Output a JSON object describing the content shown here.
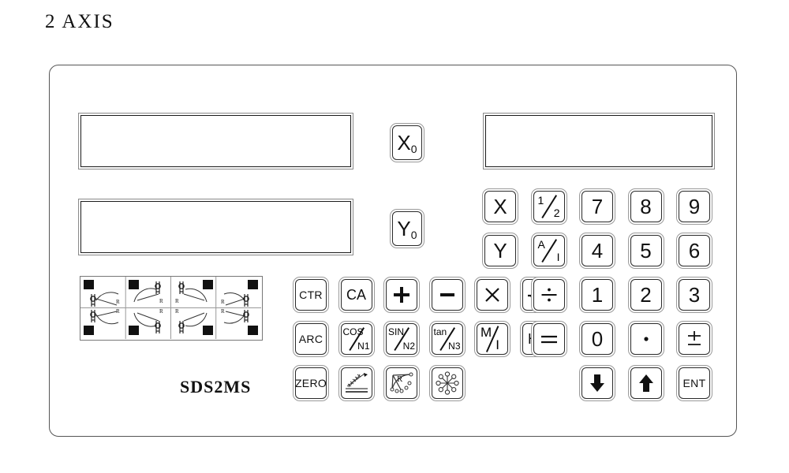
{
  "title": "2 AXIS",
  "model": "SDS2MS",
  "colors": {
    "casing_border": "#555555",
    "key_outline": "#2a2a2a",
    "key_bezel": "#9a9a9a",
    "display_outer": "#8a8a8a",
    "display_inner": "#1b1b1b",
    "label_text": "#111111",
    "background": "#ffffff"
  },
  "displays": [
    {
      "name": "x-axis-display",
      "value": ""
    },
    {
      "name": "y-axis-display",
      "value": ""
    },
    {
      "name": "aux-display",
      "value": ""
    }
  ],
  "axis_zero_keys": [
    {
      "letter": "X",
      "sub": "0",
      "name": "x-zero-key"
    },
    {
      "letter": "Y",
      "sub": "0",
      "name": "y-zero-key"
    }
  ],
  "function_keys": [
    {
      "label": "CTR",
      "name": "ctr-key",
      "kind": "text"
    },
    {
      "label": "CA",
      "name": "ca-key",
      "kind": "text"
    },
    {
      "label": "+",
      "name": "plus-key",
      "kind": "glyph"
    },
    {
      "label": "−",
      "name": "minus-key",
      "kind": "glyph"
    },
    {
      "label": "×",
      "name": "multiply-key",
      "kind": "glyph"
    },
    {
      "label": "√",
      "name": "sqrt-key",
      "kind": "glyph"
    },
    {
      "label": "ARC",
      "name": "arc-key",
      "kind": "text"
    },
    {
      "label": "COS/N1",
      "name": "cos-n1-key",
      "kind": "fraction",
      "num": "COS",
      "den": "N1"
    },
    {
      "label": "SIN/N2",
      "name": "sin-n2-key",
      "kind": "fraction",
      "num": "SIN",
      "den": "N2"
    },
    {
      "label": "tan/N3",
      "name": "tan-n3-key",
      "kind": "fraction",
      "num": "tan",
      "den": "N3"
    },
    {
      "label": "M/I",
      "name": "mm-inch-key",
      "kind": "fraction",
      "num": "M",
      "den": "I"
    },
    {
      "label": "HA",
      "name": "ha-key",
      "kind": "text"
    },
    {
      "label": "ZERO",
      "name": "zero-key",
      "kind": "text"
    },
    {
      "label": "taper-icon",
      "name": "taper-slope-key",
      "kind": "icon"
    },
    {
      "label": "arc-r-icon",
      "name": "arc-radius-key",
      "kind": "icon"
    },
    {
      "label": "pcd-icon",
      "name": "bolt-hole-circle-key",
      "kind": "icon"
    }
  ],
  "numeric_keys": [
    {
      "label": "X",
      "name": "x-axis-key",
      "kind": "text"
    },
    {
      "label": "1/2",
      "name": "half-key",
      "kind": "fraction",
      "num": "1",
      "den": "2"
    },
    {
      "label": "7",
      "name": "digit-7-key",
      "kind": "text"
    },
    {
      "label": "8",
      "name": "digit-8-key",
      "kind": "text"
    },
    {
      "label": "9",
      "name": "digit-9-key",
      "kind": "text"
    },
    {
      "label": "Y",
      "name": "y-axis-key",
      "kind": "text"
    },
    {
      "label": "A/I",
      "name": "abs-inc-key",
      "kind": "fraction",
      "num": "A",
      "den": "I"
    },
    {
      "label": "4",
      "name": "digit-4-key",
      "kind": "text"
    },
    {
      "label": "5",
      "name": "digit-5-key",
      "kind": "text"
    },
    {
      "label": "6",
      "name": "digit-6-key",
      "kind": "text"
    },
    {
      "label": "÷",
      "name": "divide-key",
      "kind": "glyph"
    },
    {
      "label": "1",
      "name": "digit-1-key",
      "kind": "text"
    },
    {
      "label": "2",
      "name": "digit-2-key",
      "kind": "text"
    },
    {
      "label": "3",
      "name": "digit-3-key",
      "kind": "text"
    },
    {
      "label": "=",
      "name": "equals-key",
      "kind": "glyph"
    },
    {
      "label": "0",
      "name": "digit-0-key",
      "kind": "text"
    },
    {
      "label": "·",
      "name": "decimal-point-key",
      "kind": "glyph"
    },
    {
      "label": "±",
      "name": "plus-minus-key",
      "kind": "glyph"
    },
    {
      "label": "down-arrow-icon",
      "name": "arrow-down-key",
      "kind": "icon"
    },
    {
      "label": "up-arrow-icon",
      "name": "arrow-up-key",
      "kind": "icon"
    },
    {
      "label": "ENT",
      "name": "enter-key",
      "kind": "text"
    }
  ],
  "reference_chart": {
    "name": "arc-reference-chart",
    "rows": 2,
    "cols": 4,
    "cell_label": "R",
    "cells": [
      {
        "name": "arc-diagram-1",
        "label": "R"
      },
      {
        "name": "arc-diagram-2",
        "label": "R"
      },
      {
        "name": "arc-diagram-3",
        "label": "R"
      },
      {
        "name": "arc-diagram-4",
        "label": "R"
      },
      {
        "name": "arc-diagram-5",
        "label": "R"
      },
      {
        "name": "arc-diagram-6",
        "label": "R"
      },
      {
        "name": "arc-diagram-7",
        "label": "R"
      },
      {
        "name": "arc-diagram-8",
        "label": "R"
      }
    ]
  }
}
